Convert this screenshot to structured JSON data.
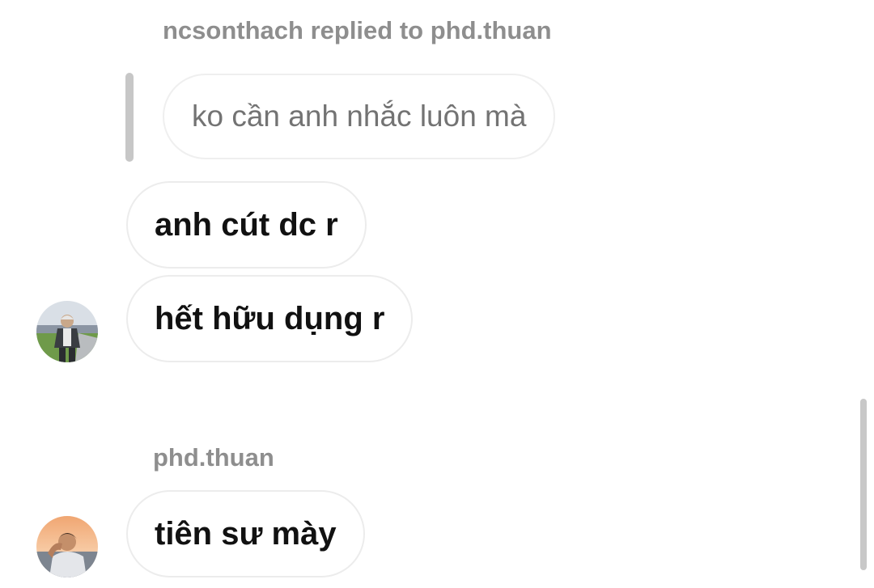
{
  "thread": {
    "reply_header": "ncsonthach replied to phd.thuan",
    "quoted_message": "ko cần anh nhắc luôn mà",
    "messages_group_1": [
      {
        "text": "anh cút dc r"
      },
      {
        "text": "hết hữu dụng r"
      }
    ],
    "sender_2": "phd.thuan",
    "messages_group_2": [
      {
        "text": "tiên sư mày"
      }
    ]
  },
  "icons": {
    "avatar_1": "user-avatar-icon",
    "avatar_2": "user-avatar-icon"
  },
  "colors": {
    "background": "#ffffff",
    "meta_text": "#8e8e8e",
    "bubble_border": "#ececec",
    "message_text": "#111111"
  }
}
